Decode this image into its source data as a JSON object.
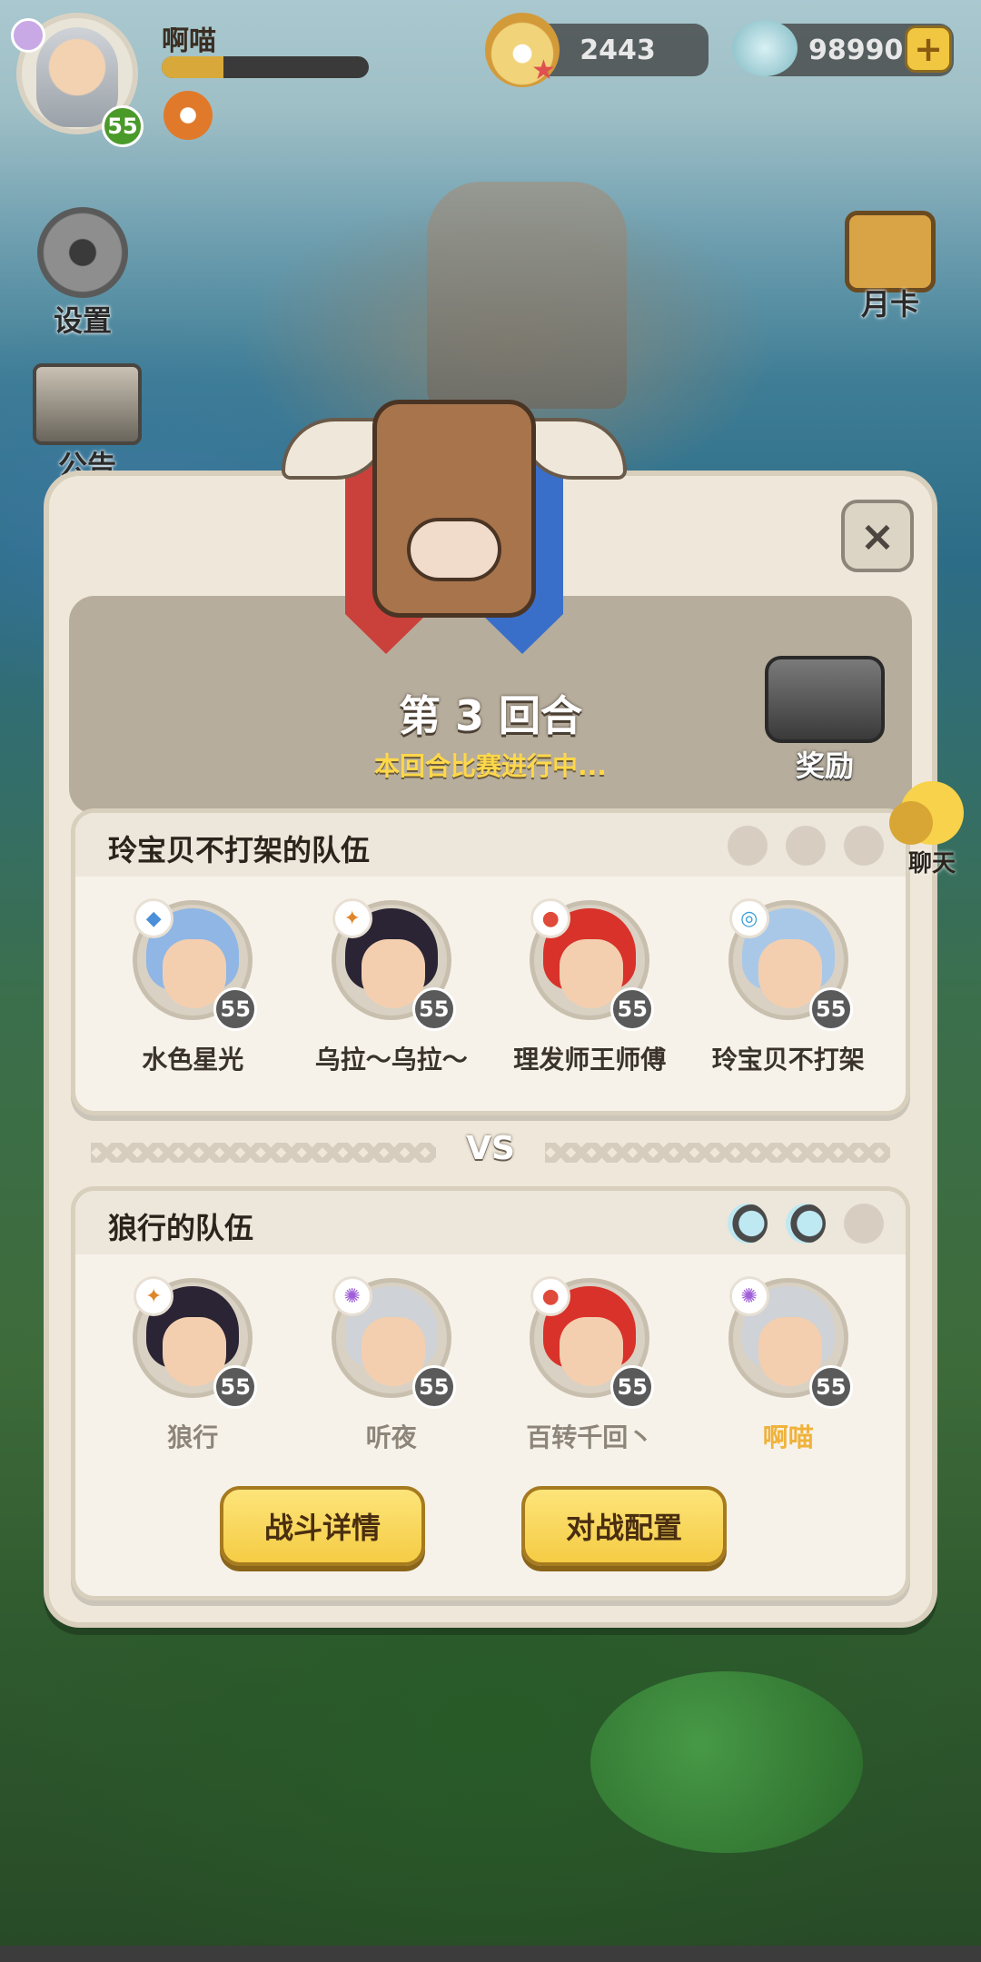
{
  "player": {
    "name": "啊喵",
    "level": "55",
    "exp_fraction": 0.3
  },
  "resources": {
    "shells": "2443",
    "gems": "98990",
    "add_label": "+"
  },
  "side_menu": {
    "settings": "设置",
    "notice": "公告",
    "month_card": "月卡"
  },
  "dialog": {
    "close_label": "×",
    "round_title": "第 3 回合",
    "round_status": "本回合比赛进行中...",
    "reward_label": "奖励",
    "vs_label": "VS"
  },
  "team_a": {
    "name": "玲宝贝不打架的队伍",
    "members": [
      {
        "name": "水色星光",
        "level": "55",
        "element": "water",
        "hair": "#8fb6e4"
      },
      {
        "name": "乌拉～乌拉～",
        "level": "55",
        "element": "fire",
        "hair": "#2a2434"
      },
      {
        "name": "理发师王师傅",
        "level": "55",
        "element": "flame",
        "hair": "#d8322a"
      },
      {
        "name": "玲宝贝不打架",
        "level": "55",
        "element": "wind",
        "hair": "#a9c8e8"
      }
    ]
  },
  "team_b": {
    "name": "狼行的队伍",
    "members": [
      {
        "name": "狼行",
        "level": "55",
        "element": "fire",
        "hair": "#2a2434"
      },
      {
        "name": "听夜",
        "level": "55",
        "element": "arcane",
        "hair": "#cfd2d6"
      },
      {
        "name": "百转千回丶",
        "level": "55",
        "element": "flame",
        "hair": "#d8322a"
      },
      {
        "name": "啊喵",
        "level": "55",
        "element": "arcane",
        "hair": "#cfd2d6"
      }
    ]
  },
  "actions": {
    "battle_detail": "战斗详情",
    "battle_config": "对战配置"
  },
  "chat": {
    "label": "聊天"
  },
  "colors": {
    "accent_yellow": "#f5cc44",
    "status_yellow": "#ffd84a",
    "self_name": "#f0b23a"
  }
}
